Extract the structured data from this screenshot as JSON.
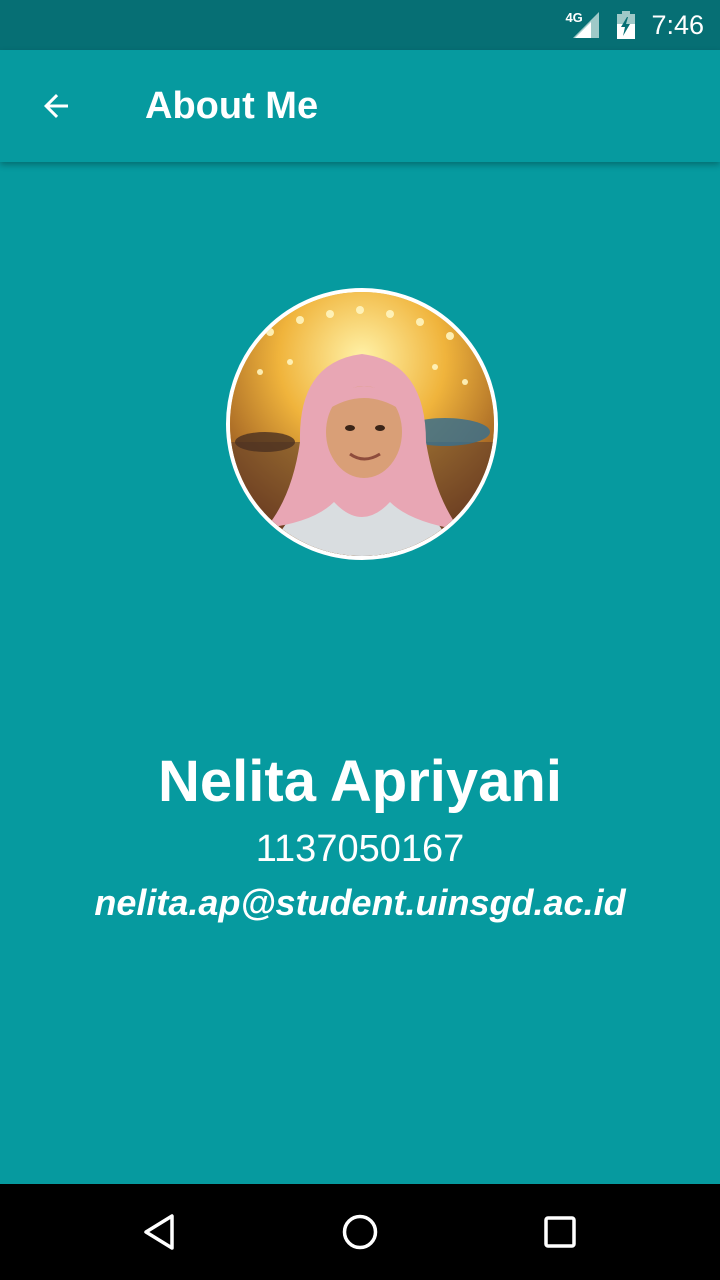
{
  "status_bar": {
    "network_label": "4G",
    "time": "7:46"
  },
  "app_bar": {
    "title": "About Me",
    "back_icon": "arrow-back-icon"
  },
  "profile": {
    "name": "Nelita Apriyani",
    "student_id": "1137050167",
    "email": "nelita.ap@student.uinsgd.ac.id"
  },
  "nav_bar": {
    "icons": [
      "back-triangle-icon",
      "home-circle-icon",
      "recents-square-icon"
    ]
  },
  "colors": {
    "primary": "#069a9f",
    "primary_dark": "#066f74",
    "text": "#ffffff"
  }
}
